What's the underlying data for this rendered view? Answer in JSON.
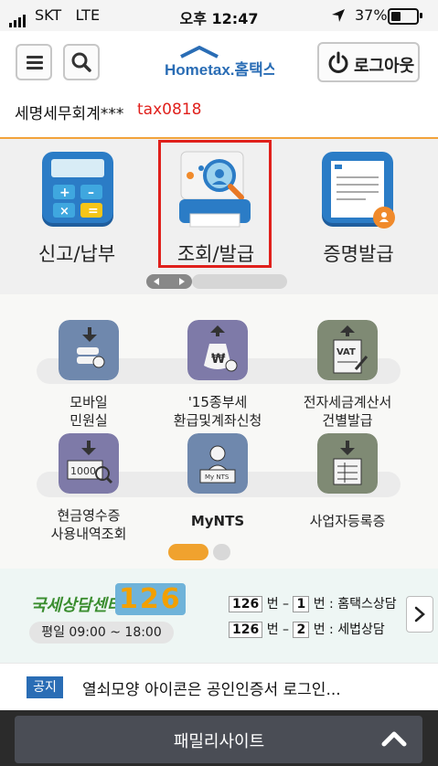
{
  "status_bar": {
    "carrier": "SKT",
    "network": "LTE",
    "time": "오후 12:47",
    "battery": "37%",
    "battery_level": 0.37
  },
  "header": {
    "logo_text": "Hometax.홈택스",
    "logout_label": "로그아웃",
    "user_name": "세명세무회계***",
    "user_id": "tax0818"
  },
  "top_menu": {
    "items": [
      {
        "label": "신고/납부",
        "icon": "calculator-icon"
      },
      {
        "label": "조회/발급",
        "icon": "lookup-printer-icon",
        "highlighted": true
      },
      {
        "label": "증명발급",
        "icon": "certificate-icon"
      }
    ]
  },
  "services": {
    "items": [
      {
        "label_1": "모바일",
        "label_2": "민원실",
        "icon": "mobile-civil-icon"
      },
      {
        "label_1": "'15종부세",
        "label_2": "환급및계좌신청",
        "icon": "money-bag-icon"
      },
      {
        "label_1": "전자세금계산서",
        "label_2": "건별발급",
        "icon": "vat-invoice-icon"
      },
      {
        "label_1": "현금영수증",
        "label_2": "사용내역조회",
        "icon": "cash-receipt-icon"
      },
      {
        "label_1": "MyNTS",
        "label_2": "",
        "icon": "mynts-id-icon"
      },
      {
        "label_1": "사업자등록증",
        "label_2": "",
        "icon": "business-registration-icon"
      }
    ],
    "page": 1,
    "page_count": 2
  },
  "consult": {
    "title": "국세상담센터",
    "number": "126",
    "hours": "평일 09:00 ~ 18:00",
    "lines": [
      {
        "num": "126",
        "sep1": "번 –",
        "sub": "1",
        "sep2": "번 :",
        "desc": "홈택스상담"
      },
      {
        "num": "126",
        "sep1": "번 –",
        "sub": "2",
        "sep2": "번 :",
        "desc": "세법상담"
      }
    ]
  },
  "notice": {
    "badge": "공지",
    "text": "열쇠모양 아이콘은 공인인증서 로그인..."
  },
  "family_site": {
    "label": "패밀리사이트"
  },
  "colors": {
    "accent_orange": "#f2a33b",
    "highlight_red": "#e0201c",
    "notice_blue": "#2a6db5"
  }
}
